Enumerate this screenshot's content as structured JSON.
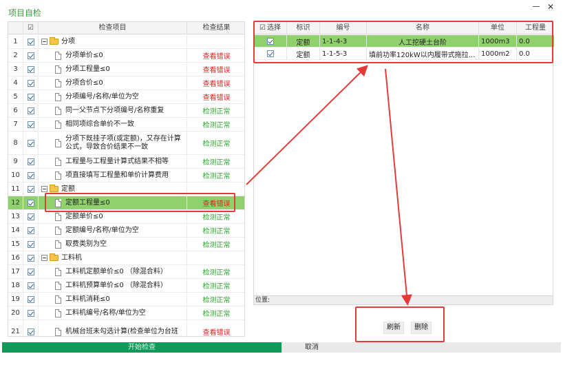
{
  "window": {
    "title": "项目自检",
    "minimize_icon": "minimize-icon",
    "close_symbol": "✕"
  },
  "left_grid": {
    "headers": {
      "checked": "☑",
      "item": "检查项目",
      "result": "检查结果"
    },
    "rows": [
      {
        "num": "1",
        "type": "group",
        "label": "分项",
        "result": ""
      },
      {
        "num": "2",
        "type": "item",
        "label": "分项单价≤0",
        "result": "查看错误",
        "status": "error"
      },
      {
        "num": "3",
        "type": "item",
        "label": "分项工程量≤0",
        "result": "查看错误",
        "status": "error"
      },
      {
        "num": "4",
        "type": "item",
        "label": "分项合价≤0",
        "result": "查看错误",
        "status": "error"
      },
      {
        "num": "5",
        "type": "item",
        "label": "分项编号/名称/单位为空",
        "result": "查看错误",
        "status": "error"
      },
      {
        "num": "6",
        "type": "item",
        "label": "同一父节点下分项编号/名称重复",
        "result": "检测正常",
        "status": "ok"
      },
      {
        "num": "7",
        "type": "item",
        "label": "相同项综合单价不一致",
        "result": "检测正常",
        "status": "ok"
      },
      {
        "num": "8",
        "type": "item",
        "label": "分项下既挂子项(或定额)，又存在计算公式，导致合价结果不一致",
        "result": "检测正常",
        "status": "ok"
      },
      {
        "num": "9",
        "type": "item",
        "label": "工程量与工程量计算式结果不相等",
        "result": "检测正常",
        "status": "ok"
      },
      {
        "num": "10",
        "type": "item",
        "label": "项直接填写工程量和单价计算费用",
        "result": "检测正常",
        "status": "ok"
      },
      {
        "num": "11",
        "type": "group",
        "label": "定额",
        "result": ""
      },
      {
        "num": "12",
        "type": "item",
        "label": "定额工程量≤0",
        "result": "查看错误",
        "status": "error",
        "selected": true
      },
      {
        "num": "13",
        "type": "item",
        "label": "定额单价≤0",
        "result": "检测正常",
        "status": "ok"
      },
      {
        "num": "14",
        "type": "item",
        "label": "定额编号/名称/单位为空",
        "result": "检测正常",
        "status": "ok"
      },
      {
        "num": "15",
        "type": "item",
        "label": "取费类别为空",
        "result": "检测正常",
        "status": "ok"
      },
      {
        "num": "16",
        "type": "group",
        "label": "工料机",
        "result": ""
      },
      {
        "num": "17",
        "type": "item",
        "label": "工料机定额单价≤0 （除混合料）",
        "result": "检测正常",
        "status": "ok"
      },
      {
        "num": "18",
        "type": "item",
        "label": "工料机预算单价≤0 （除混合料）",
        "result": "检测正常",
        "status": "ok"
      },
      {
        "num": "19",
        "type": "item",
        "label": "工料机消耗≤0",
        "result": "检测正常",
        "status": "ok"
      },
      {
        "num": "20",
        "type": "item",
        "label": "工料机编号/名称/单位为空",
        "result": "检测正常",
        "status": "ok"
      },
      {
        "num": "21",
        "type": "item",
        "label": "机械台班未勾选计算(检查单位为台班",
        "result": "查看错误",
        "status": "error"
      }
    ]
  },
  "right_grid": {
    "headers": {
      "select_box": "☑",
      "select": "选择",
      "tag": "标识",
      "code": "编号",
      "name": "名称",
      "unit": "单位",
      "qty": "工程量"
    },
    "rows": [
      {
        "tag": "定额",
        "code": "1-1-4-3",
        "name": "人工挖硬土台阶",
        "unit": "1000m3",
        "qty": "0.0",
        "selected": true
      },
      {
        "tag": "定额",
        "code": "1-1-5-3",
        "name": "填前功率120kW以内履带式拖拉...",
        "unit": "1000m2",
        "qty": "0.0",
        "selected": false
      }
    ]
  },
  "position_bar": {
    "label": "位置:"
  },
  "buttons": {
    "refresh": "刷新",
    "delete": "删除"
  },
  "footer": {
    "start": "开始检查",
    "cancel": "取消"
  },
  "colors": {
    "selected_row": "#8fd26b",
    "error_text": "#e02020",
    "ok_text": "#2aa82a",
    "footer_green": "#0f9a5a",
    "annotation_red": "#e53a3a"
  }
}
